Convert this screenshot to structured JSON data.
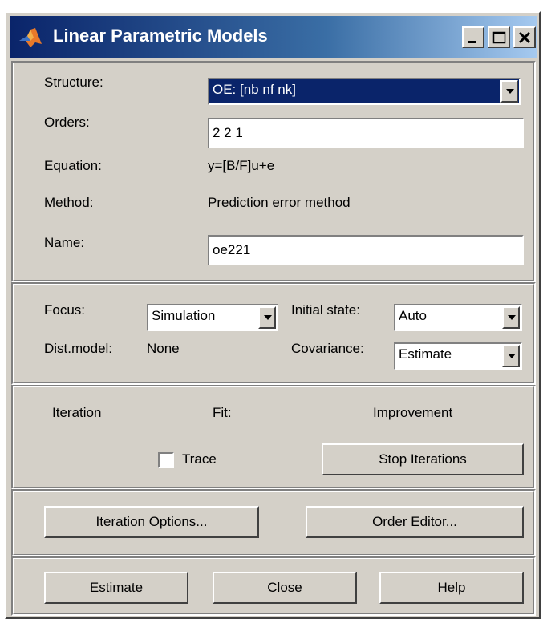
{
  "window": {
    "title": "Linear Parametric Models",
    "controls": {
      "minimize": "_",
      "maximize": "□",
      "close": "×"
    }
  },
  "model": {
    "structure_label": "Structure:",
    "structure_value": "OE: [nb nf nk]",
    "orders_label": "Orders:",
    "orders_value": "2 2 1",
    "equation_label": "Equation:",
    "equation_value": "y=[B/F]u+e",
    "method_label": "Method:",
    "method_value": "Prediction error method",
    "name_label": "Name:",
    "name_value": "oe221"
  },
  "options": {
    "focus_label": "Focus:",
    "focus_value": "Simulation",
    "dist_model_label": "Dist.model:",
    "dist_model_value": "None",
    "initial_state_label": "Initial state:",
    "initial_state_value": "Auto",
    "covariance_label": "Covariance:",
    "covariance_value": "Estimate"
  },
  "iteration": {
    "iteration_header": "Iteration",
    "fit_header": "Fit:",
    "improvement_header": "Improvement",
    "trace_label": "Trace",
    "trace_checked": false,
    "stop_button": "Stop Iterations"
  },
  "tools": {
    "iteration_options_button": "Iteration Options...",
    "order_editor_button": "Order Editor..."
  },
  "actions": {
    "estimate_button": "Estimate",
    "close_button": "Close",
    "help_button": "Help"
  }
}
